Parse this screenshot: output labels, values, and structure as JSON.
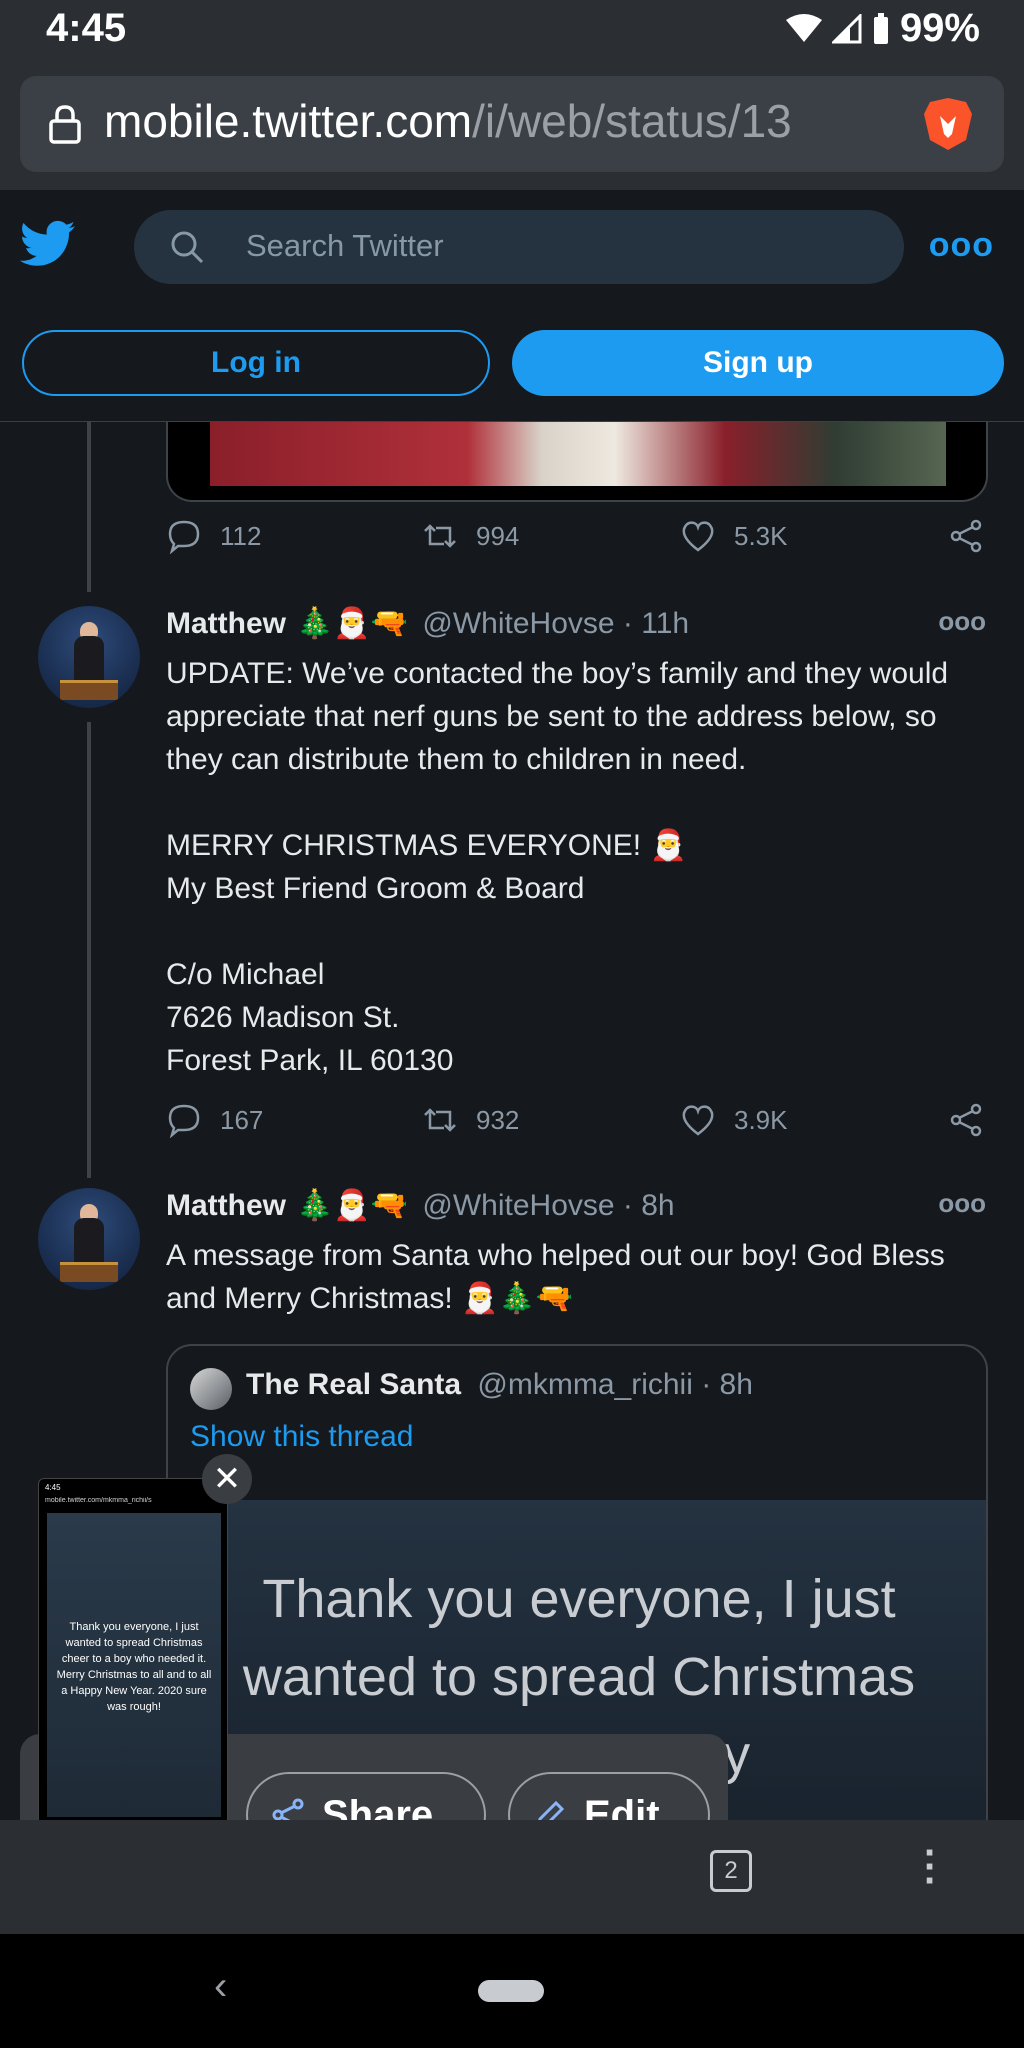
{
  "status_bar": {
    "time": "4:45",
    "battery": "99%"
  },
  "browser": {
    "url_host": "mobile.twitter.com",
    "url_path": "/i/web/status/13",
    "tab_count": "2"
  },
  "twitter": {
    "search_placeholder": "Search Twitter",
    "login_label": "Log in",
    "signup_label": "Sign up"
  },
  "prev_tweet": {
    "replies": "112",
    "retweets": "994",
    "likes": "5.3K"
  },
  "tweet1": {
    "name": "Matthew",
    "emojis": "🎄🎅🔫",
    "handle": "@WhiteHovse · 11h",
    "text": "UPDATE: We’ve contacted the boy’s family and they would appreciate that nerf guns be sent to the address below, so they can distribute them to children in need.\n\nMERRY CHRISTMAS EVERYONE! 🎅\nMy Best Friend Groom & Board\n\nC/o Michael\n7626 Madison St.\nForest Park, IL 60130",
    "replies": "167",
    "retweets": "932",
    "likes": "3.9K"
  },
  "tweet2": {
    "name": "Matthew",
    "emojis": "🎄🎅🔫",
    "handle": "@WhiteHovse · 8h",
    "text": "A message from Santa who helped out our boy! God Bless and Merry Christmas! 🎅🎄🔫",
    "quote": {
      "name": "The Real Santa",
      "handle": "@mkmma_richii · 8h",
      "show_thread": "Show this thread",
      "caption": "Thank you everyone, I just wanted to spread Christmas cheer to a boy"
    }
  },
  "thumbnail": {
    "time": "4:45",
    "url": "mobile.twitter.com/mkmma_richii/s",
    "text": "Thank you everyone, I just wanted to spread Christmas cheer to a boy who needed it. Merry Christmas to all and to all a Happy New Year. 2020 sure was rough!"
  },
  "share_panel": {
    "share_label": "Share",
    "edit_label": "Edit"
  },
  "colors": {
    "accent": "#1d9bf0",
    "background": "#15181c",
    "chrome": "#2b2f33"
  }
}
